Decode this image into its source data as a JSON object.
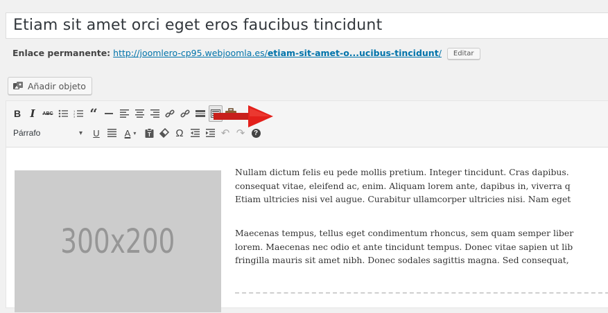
{
  "post": {
    "title": "Etiam sit amet orci eget eros faucibus tincidunt",
    "permalink_label": "Enlace permanente:",
    "permalink_base": "http://joomlero-cp95.webjoomla.es/",
    "permalink_slug": "etiam-sit-amet-o...ucibus-tincidunt",
    "permalink_trailing": "/",
    "edit_label": "Editar"
  },
  "media": {
    "add_label": "Añadir objeto",
    "icon": "media-icon"
  },
  "toolbar": {
    "row1": [
      {
        "name": "bold-button",
        "glyph": "B",
        "icon": "bold"
      },
      {
        "name": "italic-button",
        "glyph": "I",
        "icon": "italic"
      },
      {
        "name": "strikethrough-button",
        "glyph": "ABC",
        "icon": "strikethrough"
      },
      {
        "name": "bullet-list-button",
        "glyph": "☰",
        "icon": "bullet-list"
      },
      {
        "name": "numbered-list-button",
        "glyph": "☰",
        "icon": "numbered-list"
      },
      {
        "name": "blockquote-button",
        "glyph": "“",
        "icon": "blockquote"
      },
      {
        "name": "horizontal-rule-button",
        "glyph": "—",
        "icon": "horizontal-rule"
      },
      {
        "name": "align-left-button",
        "glyph": "≡",
        "icon": "align-left"
      },
      {
        "name": "align-center-button",
        "glyph": "≡",
        "icon": "align-center"
      },
      {
        "name": "align-right-button",
        "glyph": "≡",
        "icon": "align-right"
      },
      {
        "name": "insert-link-button",
        "glyph": "🔗",
        "icon": "link"
      },
      {
        "name": "remove-link-button",
        "glyph": "⛓",
        "icon": "unlink"
      },
      {
        "name": "insert-more-button",
        "glyph": "▬",
        "icon": "read-more"
      },
      {
        "name": "toolbar-toggle-button",
        "glyph": "⌨",
        "icon": "kitchen-sink"
      },
      {
        "name": "toolbox-button",
        "glyph": "🧰",
        "icon": "toolbox"
      }
    ],
    "format_select": "Párrafo",
    "format_arrow": "▾",
    "row2": [
      {
        "name": "underline-button",
        "glyph": "U",
        "icon": "underline"
      },
      {
        "name": "justify-button",
        "glyph": "≣",
        "icon": "justify"
      },
      {
        "name": "text-color-button",
        "glyph": "A",
        "icon": "text-color"
      },
      {
        "name": "paste-text-button",
        "glyph": "📋",
        "icon": "paste-as-text"
      },
      {
        "name": "clear-formatting-button",
        "glyph": "⌫",
        "icon": "eraser"
      },
      {
        "name": "special-character-button",
        "glyph": "Ω",
        "icon": "omega"
      },
      {
        "name": "outdent-button",
        "glyph": "⇤",
        "icon": "outdent"
      },
      {
        "name": "indent-button",
        "glyph": "⇥",
        "icon": "indent"
      },
      {
        "name": "undo-button",
        "glyph": "↶",
        "icon": "undo"
      },
      {
        "name": "redo-button",
        "glyph": "↷",
        "icon": "redo"
      },
      {
        "name": "help-button",
        "glyph": "?",
        "icon": "help"
      }
    ]
  },
  "content": {
    "image_placeholder": "300x200",
    "paragraph1": [
      "Nullam dictum felis eu pede mollis pretium. Integer tincidunt. Cras dapibus.",
      "consequat vitae, eleifend ac, enim. Aliquam lorem ante, dapibus in, viverra q",
      "Etiam ultricies nisi vel augue. Curabitur ullamcorper ultricies nisi. Nam eget"
    ],
    "paragraph2": [
      "Maecenas tempus, tellus eget condimentum rhoncus, sem quam semper liber",
      "lorem. Maecenas nec odio et ante tincidunt tempus. Donec vitae sapien ut lib",
      "fringilla mauris sit amet nibh. Donec sodales sagittis magna. Sed consequat,"
    ]
  },
  "colors": {
    "link": "#0073aa",
    "arrow": "#e3201b",
    "placeholder_bg": "#cccccc"
  }
}
